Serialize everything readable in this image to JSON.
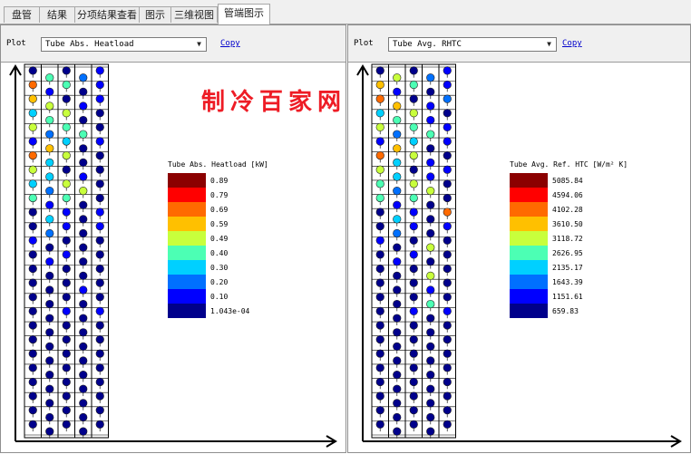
{
  "tabs": [
    {
      "label": "盘管",
      "active": false
    },
    {
      "label": "结果",
      "active": false
    },
    {
      "label": "分项结果查看",
      "active": false
    },
    {
      "label": "图示",
      "active": false
    },
    {
      "label": "三维视图",
      "active": false
    },
    {
      "label": "管端图示",
      "active": true
    }
  ],
  "panels": [
    {
      "plot_label": "Plot",
      "selected_plot": "Tube Abs. Heatload",
      "copy_label": "Copy",
      "legend": {
        "title": "Tube Abs. Heatload [kW]",
        "entries": [
          {
            "value": "0.89",
            "color": "#8b0000"
          },
          {
            "value": "0.79",
            "color": "#ff0000"
          },
          {
            "value": "0.69",
            "color": "#ff6a00"
          },
          {
            "value": "0.59",
            "color": "#ffc000"
          },
          {
            "value": "0.49",
            "color": "#c8ff3c"
          },
          {
            "value": "0.40",
            "color": "#4cffb4"
          },
          {
            "value": "0.30",
            "color": "#00d0ff"
          },
          {
            "value": "0.20",
            "color": "#0070ff"
          },
          {
            "value": "0.10",
            "color": "#0000ff"
          },
          {
            "value": "1.043e-04",
            "color": "#00008b"
          }
        ]
      }
    },
    {
      "plot_label": "Plot",
      "selected_plot": "Tube Avg. RHTC",
      "copy_label": "Copy",
      "legend": {
        "title": "Tube Avg. Ref. HTC [W/m² K]",
        "entries": [
          {
            "value": "5085.84",
            "color": "#8b0000"
          },
          {
            "value": "4594.06",
            "color": "#ff0000"
          },
          {
            "value": "4102.28",
            "color": "#ff6a00"
          },
          {
            "value": "3610.50",
            "color": "#ffc000"
          },
          {
            "value": "3118.72",
            "color": "#c8ff3c"
          },
          {
            "value": "2626.95",
            "color": "#4cffb4"
          },
          {
            "value": "2135.17",
            "color": "#00d0ff"
          },
          {
            "value": "1643.39",
            "color": "#0070ff"
          },
          {
            "value": "1151.61",
            "color": "#0000ff"
          },
          {
            "value": "659.83",
            "color": "#00008b"
          }
        ]
      }
    }
  ],
  "tube_levels": [
    [
      1,
      5,
      1,
      3,
      2
    ],
    [
      8,
      2,
      5,
      1,
      2
    ],
    [
      7,
      6,
      1,
      2,
      2
    ],
    [
      4,
      5,
      6,
      1,
      1
    ],
    [
      6,
      3,
      5,
      5,
      1
    ],
    [
      2,
      7,
      4,
      1,
      2
    ],
    [
      8,
      4,
      6,
      1,
      1
    ],
    [
      6,
      4,
      1,
      2,
      1
    ],
    [
      4,
      3,
      6,
      6,
      1
    ],
    [
      5,
      2,
      5,
      1,
      1
    ],
    [
      1,
      4,
      2,
      1,
      2
    ],
    [
      1,
      3,
      2,
      1,
      2
    ],
    [
      2,
      1,
      1,
      1,
      1
    ],
    [
      1,
      2,
      2,
      1,
      1
    ],
    [
      1,
      1,
      1,
      1,
      1
    ],
    [
      1,
      1,
      1,
      2,
      1
    ],
    [
      1,
      1,
      1,
      1,
      1
    ],
    [
      1,
      1,
      2,
      1,
      2
    ],
    [
      1,
      1,
      1,
      1,
      1
    ],
    [
      1,
      1,
      1,
      1,
      1
    ],
    [
      1,
      1,
      1,
      1,
      1
    ],
    [
      1,
      1,
      1,
      1,
      1
    ],
    [
      1,
      1,
      1,
      1,
      1
    ],
    [
      1,
      1,
      1,
      1,
      1
    ],
    [
      1,
      1,
      1,
      1,
      1
    ],
    [
      1,
      1,
      1,
      1,
      1
    ]
  ],
  "tube_levels_htc": [
    [
      1,
      6,
      1,
      3,
      2
    ],
    [
      7,
      2,
      5,
      1,
      2
    ],
    [
      8,
      7,
      1,
      2,
      3
    ],
    [
      4,
      5,
      6,
      2,
      1
    ],
    [
      6,
      3,
      5,
      5,
      2
    ],
    [
      2,
      7,
      4,
      1,
      2
    ],
    [
      8,
      4,
      6,
      2,
      1
    ],
    [
      6,
      4,
      1,
      2,
      2
    ],
    [
      5,
      3,
      6,
      6,
      1
    ],
    [
      5,
      2,
      5,
      1,
      1
    ],
    [
      1,
      4,
      2,
      1,
      8
    ],
    [
      1,
      3,
      2,
      1,
      2
    ],
    [
      2,
      1,
      1,
      6,
      1
    ],
    [
      1,
      2,
      2,
      1,
      1
    ],
    [
      1,
      1,
      1,
      6,
      1
    ],
    [
      1,
      1,
      1,
      2,
      1
    ],
    [
      1,
      1,
      1,
      5,
      1
    ],
    [
      1,
      1,
      2,
      1,
      2
    ],
    [
      1,
      1,
      1,
      1,
      1
    ],
    [
      1,
      1,
      1,
      1,
      1
    ],
    [
      1,
      1,
      1,
      1,
      1
    ],
    [
      1,
      1,
      1,
      1,
      1
    ],
    [
      1,
      1,
      1,
      1,
      1
    ],
    [
      1,
      1,
      1,
      1,
      1
    ],
    [
      1,
      1,
      1,
      1,
      1
    ],
    [
      1,
      1,
      1,
      1,
      1
    ]
  ],
  "watermark": "制冷百家网"
}
